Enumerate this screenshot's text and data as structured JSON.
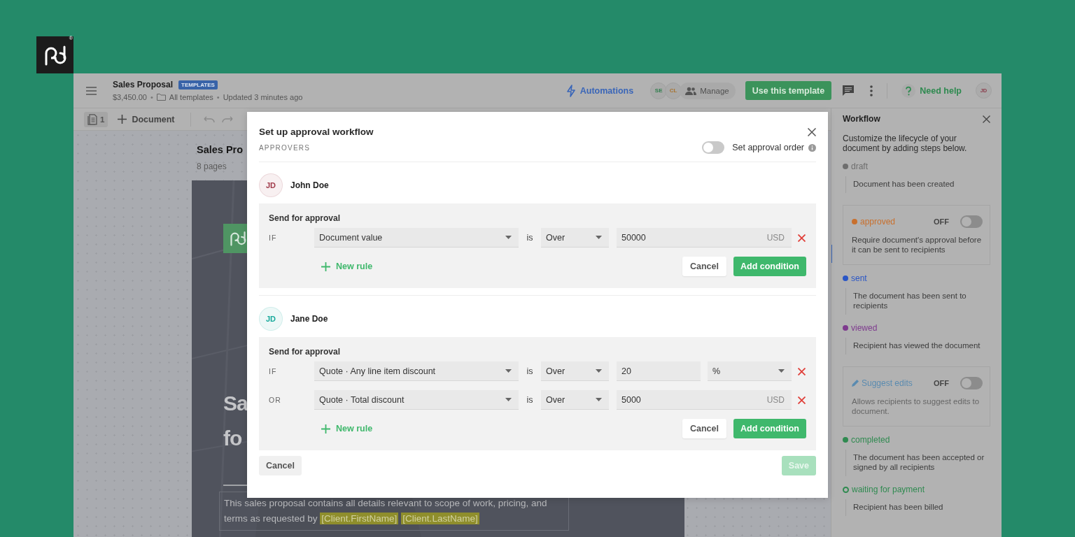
{
  "logo": {
    "mark": "®"
  },
  "topbar": {
    "title": "Sales Proposal",
    "badge": "TEMPLATES",
    "price": "$3,450.00",
    "separators": [
      "•",
      "•"
    ],
    "folder": "All templates",
    "updated": "Updated 3 minutes ago",
    "automations": "Automations",
    "collaborators": [
      {
        "initials": "SE",
        "color": "#2f7d4c"
      },
      {
        "initials": "CL",
        "color": "#a8732f"
      }
    ],
    "manage": "Manage",
    "use_template": "Use this template",
    "help": "Need help",
    "user_initials": "JD"
  },
  "toolbar": {
    "page_count": "1",
    "add_document": "Document"
  },
  "document": {
    "title": "Sales Pro",
    "pages": "8 pages",
    "heading_lines": [
      "Sa",
      "fo"
    ],
    "description": "This sales proposal contains all details relevant to scope of work, pricing, and terms as requested by",
    "tokens": [
      "[Client.FirstName]",
      "[Client.LastName]"
    ]
  },
  "workflow": {
    "title": "Workflow",
    "intro": "Customize the lifecycle of your document by adding steps below.",
    "steps": [
      {
        "kind": "status",
        "label": "draft",
        "color": "#6e6e6e",
        "description": "Document has been created"
      },
      {
        "kind": "toggle",
        "label": "approved",
        "color": "#c8702e",
        "state_label": "OFF",
        "on": false,
        "disabled": false,
        "description": "Require document's approval before it can be sent to recipients"
      },
      {
        "kind": "status",
        "label": "sent",
        "color": "#2a56c6",
        "description": "The document has been sent to recipients"
      },
      {
        "kind": "status",
        "label": "viewed",
        "color": "#7e3a8e",
        "description": "Recipient has viewed the document"
      },
      {
        "kind": "feature",
        "label": "Suggest edits",
        "color": "#5a8bb0",
        "state_label": "OFF",
        "on": false,
        "disabled": true,
        "description": "Allows recipients to suggest edits to document."
      },
      {
        "kind": "status",
        "label": "completed",
        "color": "#2f8a50",
        "description": "The document has been accepted or signed by all recipients"
      },
      {
        "kind": "pending",
        "label": "waiting for payment",
        "color": "#2f8a50",
        "description": "Recipient has been billed"
      }
    ]
  },
  "modal": {
    "title": "Set up approval workflow",
    "section_label": "APPROVERS",
    "approval_order": {
      "label": "Set approval order",
      "on": false
    },
    "approvers": [
      {
        "initials": "JD",
        "name": "John Doe",
        "color": "#a03a4a",
        "section_title": "Send for approval",
        "rules": [
          {
            "connector": "IF",
            "field": "Document value",
            "comparator": "is",
            "operator": "Over",
            "value": "50000",
            "unit": {
              "kind": "suffix",
              "text": "USD"
            }
          }
        ],
        "new_rule": "New rule",
        "cancel": "Cancel",
        "add_condition": "Add condition"
      },
      {
        "initials": "JD",
        "name": "Jane Doe",
        "color": "#17a99b",
        "section_title": "Send for approval",
        "rules": [
          {
            "connector": "IF",
            "field": "Quote · Any line item discount",
            "comparator": "is",
            "operator": "Over",
            "value": "20",
            "unit": {
              "kind": "select",
              "text": "%"
            }
          },
          {
            "connector": "OR",
            "field": "Quote · Total discount",
            "comparator": "is",
            "operator": "Over",
            "value": "5000",
            "unit": {
              "kind": "suffix",
              "text": "USD"
            }
          }
        ],
        "new_rule": "New rule",
        "cancel": "Cancel",
        "add_condition": "Add condition"
      }
    ],
    "cancel": "Cancel",
    "save": {
      "label": "Save",
      "disabled": true
    }
  }
}
